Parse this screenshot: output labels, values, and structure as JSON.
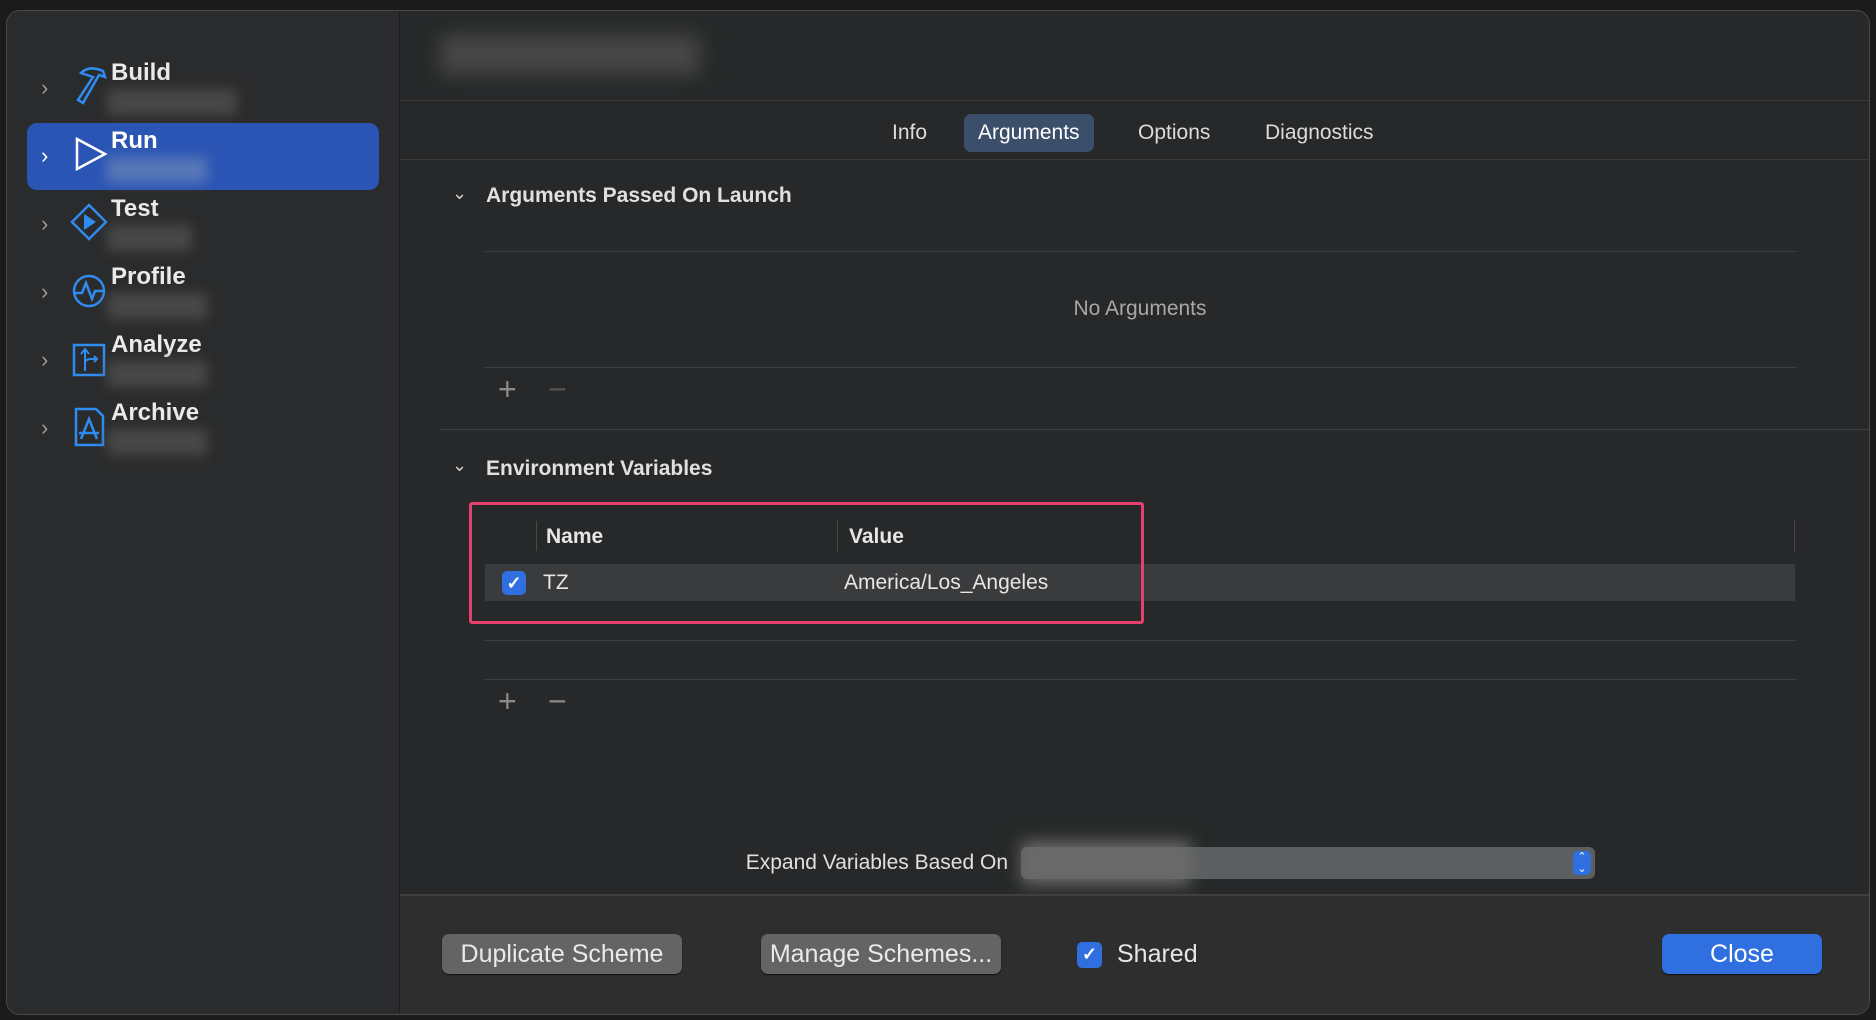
{
  "sidebar": {
    "items": [
      {
        "label": "Build",
        "icon": "hammer-icon",
        "selected": false
      },
      {
        "label": "Run",
        "icon": "play-icon",
        "selected": true
      },
      {
        "label": "Test",
        "icon": "test-diamond-icon",
        "selected": false
      },
      {
        "label": "Profile",
        "icon": "profile-waveform-icon",
        "selected": false
      },
      {
        "label": "Analyze",
        "icon": "analyze-icon",
        "selected": false
      },
      {
        "label": "Archive",
        "icon": "archive-icon",
        "selected": false
      }
    ]
  },
  "tabs": [
    {
      "label": "Info"
    },
    {
      "label": "Arguments",
      "active": true
    },
    {
      "label": "Options"
    },
    {
      "label": "Diagnostics"
    }
  ],
  "arguments": {
    "title": "Arguments Passed On Launch",
    "empty": "No Arguments"
  },
  "env": {
    "title": "Environment Variables",
    "col_name": "Name",
    "col_value": "Value",
    "rows": [
      {
        "enabled": true,
        "name": "TZ",
        "value": "America/Los_Angeles"
      }
    ]
  },
  "expand": {
    "label": "Expand Variables Based On"
  },
  "footer": {
    "duplicate": "Duplicate Scheme",
    "manage": "Manage Schemes...",
    "shared": "Shared",
    "shared_checked": true,
    "close": "Close"
  },
  "colors": {
    "accent": "#2f6fe0",
    "selection": "#2b55b4",
    "highlight_box": "#e6406c"
  }
}
